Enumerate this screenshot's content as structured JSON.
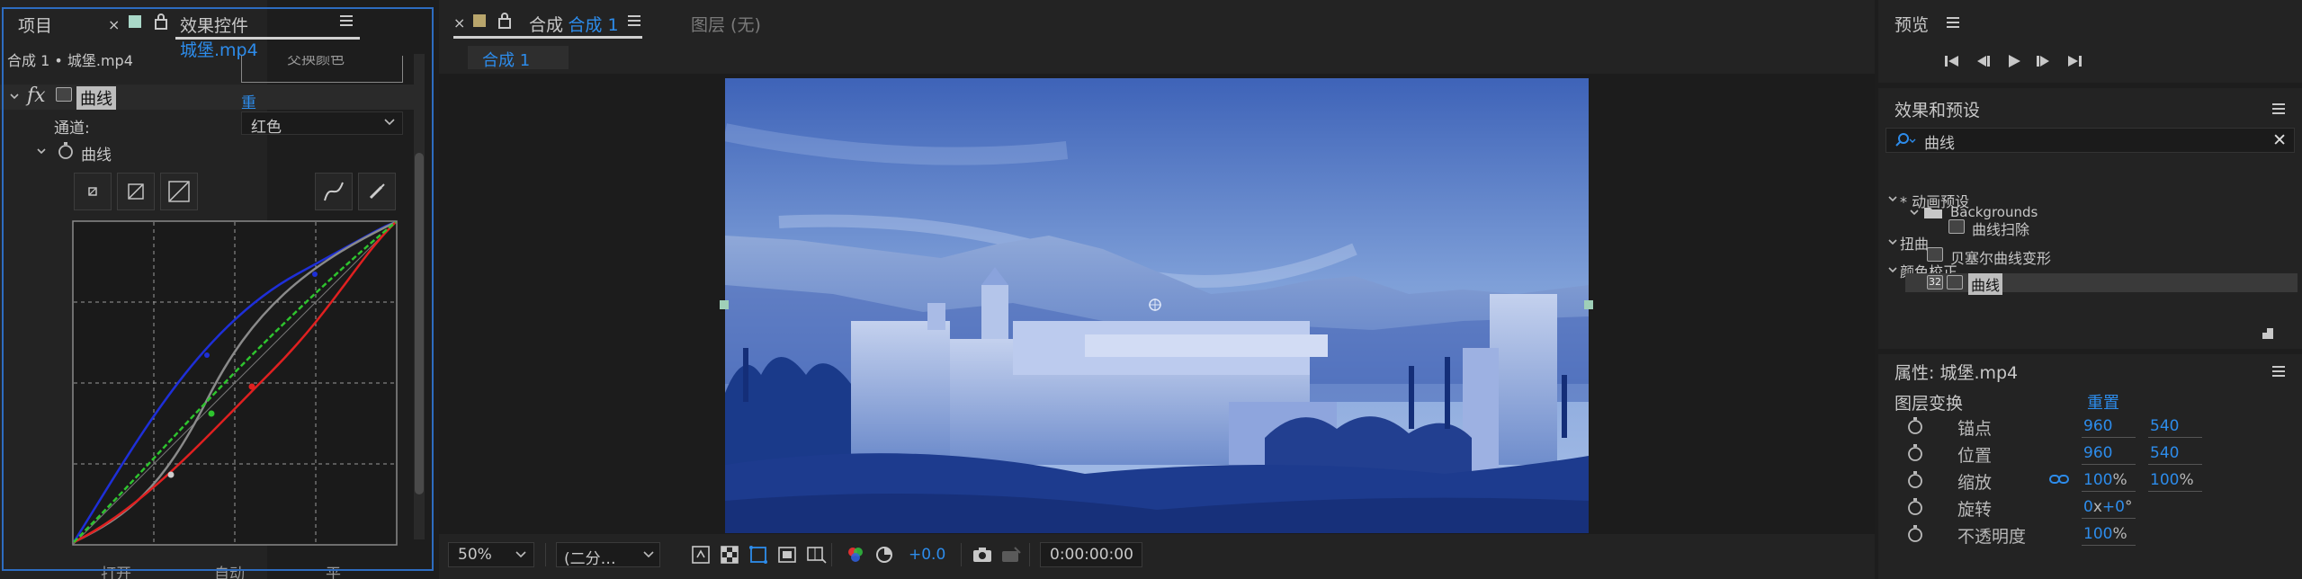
{
  "left_panel": {
    "tab_project": "项目",
    "tab_effects_prefix": "效果控件",
    "tab_effects_file": "城堡.mp4",
    "breadcrumb": "合成 1 • 城堡.mp4",
    "partial_button": "交换颜色",
    "fx_label": "fx",
    "effect_name": "曲线",
    "reset": "重置",
    "channel_label": "通道:",
    "channel_value": "红色",
    "curves_label": "曲线",
    "bottom_partial": [
      "打开",
      "自动",
      "平滑"
    ]
  },
  "center_panel": {
    "tab_prefix": "合成",
    "tab_name": "合成 1",
    "layer_tab": "图层 (无)",
    "subtab": "合成 1",
    "zoom": "50%",
    "resolution": "(二分…",
    "exposure": "+0.0",
    "timecode": "0:00:00:00"
  },
  "preview": {
    "title": "预览"
  },
  "effects_presets": {
    "title": "效果和预设",
    "search_value": "曲线",
    "tree": [
      {
        "label": "* 动画预设",
        "level": 0
      },
      {
        "label": "Backgrounds",
        "level": 1
      },
      {
        "label": "曲线扫除",
        "level": 2
      },
      {
        "label": "扭曲",
        "level": 0
      },
      {
        "label": "贝塞尔曲线变形",
        "level": 2
      },
      {
        "label": "颜色校正",
        "level": 0
      },
      {
        "label": "曲线",
        "level": 2
      }
    ],
    "badge_32": "32"
  },
  "properties": {
    "title": "属性: 城堡.mp4",
    "section": "图层变换",
    "reset": "重置",
    "rows": [
      {
        "label": "锚点",
        "v1": "960",
        "v2": "540"
      },
      {
        "label": "位置",
        "v1": "960",
        "v2": "540"
      },
      {
        "label": "缩放",
        "v1": "100",
        "v2": "100",
        "unit": "%"
      },
      {
        "label": "旋转",
        "v1": "0",
        "v1_unit": "x",
        "v2": "+0",
        "v2_unit": "°"
      },
      {
        "label": "不透明度",
        "v1": "100",
        "unit": "%"
      }
    ]
  },
  "colors": {
    "accent": "#2d8ceb",
    "panel_bg": "#232323",
    "app_bg": "#1d1d1d"
  }
}
